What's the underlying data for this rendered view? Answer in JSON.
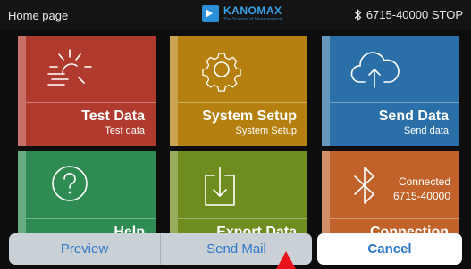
{
  "status_bar": {
    "title": "Home page",
    "brand": "KANOMAX",
    "brand_tagline": "The Science of Measurement",
    "device": "6715-40000 STOP",
    "icons": [
      "kanomax-logo-icon",
      "bluetooth-icon"
    ]
  },
  "tiles": [
    {
      "id": "test-data",
      "label": "Test Data",
      "sublabel": "Test data",
      "icon": "sun-icon",
      "color": "#b03a2d"
    },
    {
      "id": "system-setup",
      "label": "System Setup",
      "sublabel": "System Setup",
      "icon": "gear-icon",
      "color": "#b5800f"
    },
    {
      "id": "send-data",
      "label": "Send Data",
      "sublabel": "Send data",
      "icon": "cloud-upload-icon",
      "color": "#2a6fa7"
    },
    {
      "id": "help",
      "label": "Help",
      "icon": "question-icon",
      "color": "#2e8c52"
    },
    {
      "id": "export-data",
      "label": "Export Data",
      "icon": "download-box-icon",
      "color": "#6f8c1f"
    },
    {
      "id": "connection",
      "label": "Connection",
      "status_line1": "Connected",
      "status_line2": "6715-40000",
      "icon": "bluetooth-icon",
      "color": "#c0622a"
    }
  ],
  "action_sheet": {
    "preview_label": "Preview",
    "send_mail_label": "Send Mail",
    "cancel_label": "Cancel"
  },
  "colors": {
    "accent": "#2d78c8",
    "pointer": "#e8141c"
  }
}
